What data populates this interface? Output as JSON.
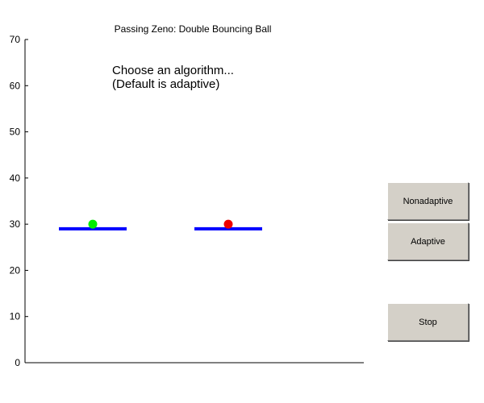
{
  "figure": {
    "title": "Passing Zeno: Double Bouncing Ball",
    "background_color": "#ffffff"
  },
  "plot": {
    "annotation_lines": [
      "Choose an algorithm...",
      "(Default is adaptive)"
    ],
    "y_axis": {
      "range": [
        0,
        70
      ],
      "ticks": [
        "0",
        "10",
        "20",
        "30",
        "40",
        "50",
        "60",
        "70"
      ]
    },
    "platforms": [
      {
        "name": "left-platform",
        "x_range": [
          1,
          3
        ],
        "y": 29,
        "color": "#0000ff"
      },
      {
        "name": "right-platform",
        "x_range": [
          5,
          7
        ],
        "y": 29,
        "color": "#0000ff"
      }
    ],
    "balls": [
      {
        "name": "green-ball",
        "x": 2,
        "y": 30,
        "color": "#00ee00"
      },
      {
        "name": "red-ball",
        "x": 6,
        "y": 30,
        "color": "#ee0000"
      }
    ],
    "x_range": [
      0,
      10
    ]
  },
  "controls": {
    "nonadaptive_label": "Nonadaptive",
    "adaptive_label": "Adaptive",
    "stop_label": "Stop"
  },
  "colors": {
    "button_face": "#d4d0c8",
    "axis": "#000000"
  }
}
